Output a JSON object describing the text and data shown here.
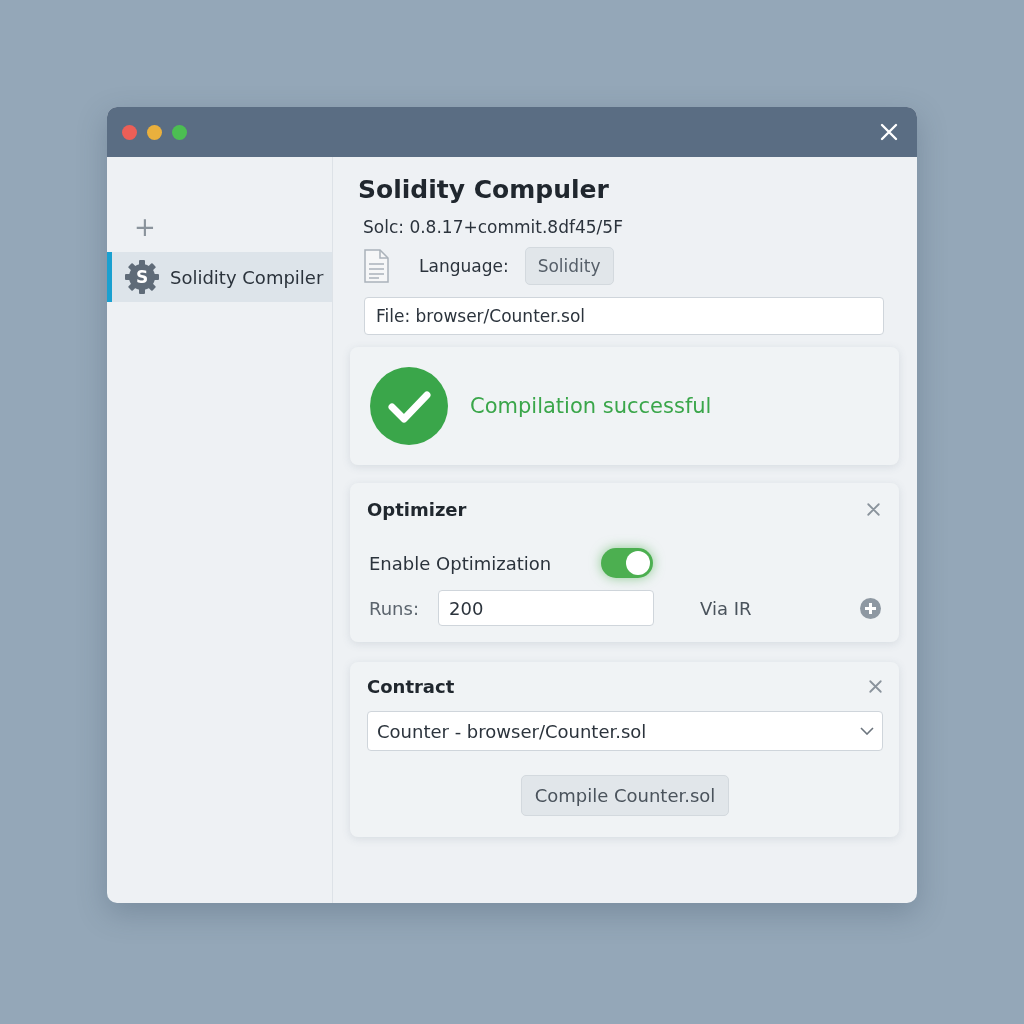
{
  "sidebar": {
    "add_label": "+",
    "items": [
      {
        "label": "Solidity Compiler",
        "icon_letter": "S",
        "selected": true
      }
    ]
  },
  "main": {
    "title": "Solidity Compuler",
    "version": "Solc: 0.8.17+commit.8df45/5F",
    "language_label": "Language:",
    "language_value": "Solidity",
    "file_field": "File: browser/Counter.sol"
  },
  "status": {
    "message": "Compilation successful",
    "success": true
  },
  "optimizer": {
    "title": "Optimizer",
    "enable_label": "Enable Optimization",
    "enabled": true,
    "runs_label": "Runs:",
    "runs_value": "200",
    "via_ir_label": "Via IR"
  },
  "contract": {
    "title": "Contract",
    "selected_contract": "Counter - browser/Counter.sol",
    "compile_button": "Compile Counter.sol"
  }
}
